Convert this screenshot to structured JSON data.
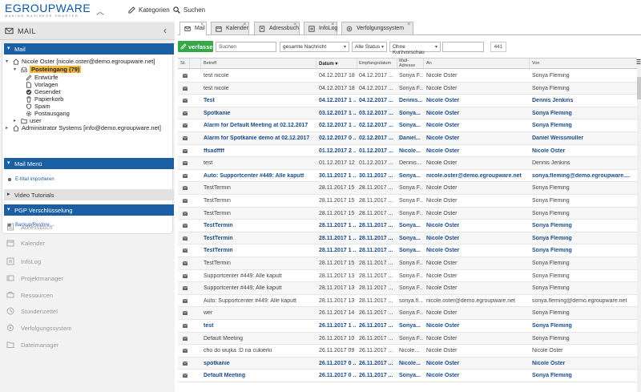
{
  "header": {
    "logo_main": "EGROUPWARE",
    "logo_tagline": "MAKING BUSINESS SMARTER",
    "links": [
      {
        "label": "Kategorien",
        "icon": "edit-icon"
      },
      {
        "label": "Suchen",
        "icon": "search-icon"
      }
    ]
  },
  "sidebar": {
    "app_title": "MAIL",
    "mail_section": "Mail",
    "account": "Nicole Oster [nicole.oster@demo.egroupware.net]",
    "folders": [
      {
        "label": "Posteingang (79)",
        "icon": "inbox-icon",
        "selected": true
      },
      {
        "label": "Entwürfe",
        "icon": "pencil-icon"
      },
      {
        "label": "Vorlagen",
        "icon": "document-icon"
      },
      {
        "label": "Gesendet",
        "icon": "check-icon"
      },
      {
        "label": "Papierkorb",
        "icon": "trash-icon"
      },
      {
        "label": "Spam",
        "icon": "shield-icon"
      },
      {
        "label": "Postausgang",
        "icon": "gear-icon"
      }
    ],
    "user_folder": "user",
    "account2": "Administrator Systems [info@demo.egroupware.net]",
    "mail_menu": "Mail Menü",
    "import_link": "E-Mail importieren",
    "video_tutorials": "Video Tutorials",
    "pgp": "PGP Verschlüsselung",
    "backup_link": "Backup/Restore ...",
    "apps": [
      {
        "label": "Adressbuch",
        "icon": "addressbook-icon"
      },
      {
        "label": "Kalender",
        "icon": "calendar-icon"
      },
      {
        "label": "InfoLog",
        "icon": "infolog-icon"
      },
      {
        "label": "Projektmanager",
        "icon": "project-icon"
      },
      {
        "label": "Ressourcen",
        "icon": "resources-icon"
      },
      {
        "label": "Stundenzettel",
        "icon": "timesheet-icon"
      },
      {
        "label": "Verfolgungssystem",
        "icon": "tracker-icon"
      },
      {
        "label": "Dateimanager",
        "icon": "folder-icon"
      }
    ]
  },
  "tabs": [
    {
      "label": "Mail",
      "active": true
    },
    {
      "label": "Kalender"
    },
    {
      "label": "Adressbuch"
    },
    {
      "label": "InfoLog"
    },
    {
      "label": "Verfolgungssystem"
    }
  ],
  "toolbar": {
    "compose": "verfassen",
    "search_placeholder": "Suchen",
    "search_scope": "gesamte Nachricht",
    "status_filter": "Alle Status",
    "preview_filter": "Ohne Kurzvorschau",
    "count": "441"
  },
  "columns": [
    "St.",
    "",
    "Betreff",
    "Datum",
    "Empfangsdatum",
    "Mail-Adresse",
    "An",
    "Von"
  ],
  "rows": [
    {
      "subject": "test nicole",
      "date": "04.12.2017 18 ...",
      "received": "04.12.2017 ...",
      "mail": "Sonya F...",
      "to": "Nicole Oster",
      "from": "Sonya Fleming",
      "unread": false
    },
    {
      "subject": "test nicole",
      "date": "04.12.2017 18 ...",
      "received": "04.12.2017 ...",
      "mail": "Sonya F...",
      "to": "Nicole Oster",
      "from": "Sonya Fleming",
      "unread": false
    },
    {
      "subject": "Test",
      "date": "04.12.2017 1 ...",
      "received": "04.12.2017 ...",
      "mail": "Dennis...",
      "to": "Nicole Oster",
      "from": "Dennis Jenkins",
      "unread": true
    },
    {
      "subject": "Spotkanie",
      "date": "03.12.2017 1 ...",
      "received": "03.12.2017 ...",
      "mail": "Sonya...",
      "to": "Nicole Oster",
      "from": "Sonya Fleming",
      "unread": true
    },
    {
      "subject": "Alarm for Default Meeting at 02.12.2017",
      "date": "02.12.2017 1 ...",
      "received": "02.12.2017 ...",
      "mail": "Sonya...",
      "to": "Nicole Oster",
      "from": "Sonya Fleming",
      "unread": true
    },
    {
      "subject": "Alarm for Spotkanie demo at 02.12.2017",
      "date": "02.12.2017 0 ...",
      "received": "02.12.2017 ...",
      "mail": "Daniel...",
      "to": "Nicole Oster",
      "from": "Daniel Weissmuller",
      "unread": true
    },
    {
      "subject": "ffsadffff",
      "date": "01.12.2017 2 ...",
      "received": "01.12.2017 ...",
      "mail": "Nicole...",
      "to": "Nicole Oster",
      "from": "Nicole Oster",
      "unread": true
    },
    {
      "subject": "test",
      "date": "01.12.2017 12 ...",
      "received": "01.12.2017 ...",
      "mail": "Dennis...",
      "to": "Nicole Oster",
      "from": "Dennis Jenkins",
      "unread": false
    },
    {
      "subject": "Auto: Supportcenter #449: Alle kaputt",
      "date": "30.11.2017 1 ...",
      "received": "30.11.2017 ...",
      "mail": "Sonya...",
      "to": "nicole.oster@demo.egroupware.net",
      "from": "sonya.fleming@demo.egroupware....",
      "unread": true
    },
    {
      "subject": "TestTermin",
      "date": "28.11.2017 15 ...",
      "received": "28.11.2017 ...",
      "mail": "Sonya F...",
      "to": "Nicole Oster",
      "from": "Sonya Fleming",
      "unread": false
    },
    {
      "subject": "TestTermin",
      "date": "28.11.2017 15 ...",
      "received": "28.11.2017 ...",
      "mail": "Sonya F...",
      "to": "Nicole Oster",
      "from": "Sonya Fleming",
      "unread": false
    },
    {
      "subject": "TestTermin",
      "date": "28.11.2017 15 ...",
      "received": "28.11.2017 ...",
      "mail": "Sonya F...",
      "to": "Nicole Oster",
      "from": "Sonya Fleming",
      "unread": false
    },
    {
      "subject": "TestTermin",
      "date": "28.11.2017 1 ...",
      "received": "28.11.2017 ...",
      "mail": "Sonya...",
      "to": "Nicole Oster",
      "from": "Sonya Fleming",
      "unread": true
    },
    {
      "subject": "TestTermin",
      "date": "28.11.2017 1 ...",
      "received": "28.11.2017 ...",
      "mail": "Sonya...",
      "to": "Nicole Oster",
      "from": "Sonya Fleming",
      "unread": true
    },
    {
      "subject": "TestTermin",
      "date": "28.11.2017 1 ...",
      "received": "28.11.2017 ...",
      "mail": "Sonya...",
      "to": "Nicole Oster",
      "from": "Sonya Fleming",
      "unread": true
    },
    {
      "subject": "TestTermin",
      "date": "28.11.2017 15 ...",
      "received": "28.11.2017 ...",
      "mail": "Sonya F...",
      "to": "Nicole Oster",
      "from": "Sonya Fleming",
      "unread": false
    },
    {
      "subject": "Supportcenter #449: Alle kaputt",
      "date": "28.11.2017 13 ...",
      "received": "28.11.2017 ...",
      "mail": "Sonya F...",
      "to": "Nicole Oster",
      "from": "Sonya Fleming",
      "unread": false
    },
    {
      "subject": "Supportcenter #449: Alle kaputt",
      "date": "28.11.2017 13 ...",
      "received": "28.11.2017 ...",
      "mail": "Sonya F...",
      "to": "Nicole Oster",
      "from": "Sonya Fleming",
      "unread": false
    },
    {
      "subject": "Auto: Supportcenter #449: Alle kaputt",
      "date": "28.11.2017 13 ...",
      "received": "28.11.2017 ...",
      "mail": "sonya.fl...",
      "to": "nicole.oster@demo.egroupware.net",
      "from": "sonya.fleming@demo.egroupware.net",
      "unread": false
    },
    {
      "subject": "wer",
      "date": "26.11.2017 14 ...",
      "received": "26.11.2017 ...",
      "mail": "Sonya F...",
      "to": "Nicole Oster",
      "from": "Sonya Fleming",
      "unread": false
    },
    {
      "subject": "test",
      "date": "26.11.2017 1 ...",
      "received": "26.11.2017 ...",
      "mail": "Sonya...",
      "to": "Nicole Oster",
      "from": "Sonya Fleming",
      "unread": true
    },
    {
      "subject": "Default Meeting",
      "date": "26.11.2017 10 ...",
      "received": "26.11.2017 ...",
      "mail": "Sonya F...",
      "to": "Nicole Oster",
      "from": "Sonya Fleming",
      "unread": false
    },
    {
      "subject": "cho do wujka :D na cukierki",
      "date": "26.11.2017 09 ...",
      "received": "26.11.2017 ...",
      "mail": "Nicole...",
      "to": "Nicole Oster",
      "from": "Nicole Oster",
      "unread": false
    },
    {
      "subject": "spotkanie",
      "date": "26.11.2017 0 ...",
      "received": "26.11.2017 ...",
      "mail": "Nicole...",
      "to": "Nicole Oster",
      "from": "Nicole Oster",
      "unread": true
    },
    {
      "subject": "Default Meeting",
      "date": "26.11.2017 0 ...",
      "received": "26.11.2017 ...",
      "mail": "Sonya...",
      "to": "Nicole Oster",
      "from": "Sonya Fleming",
      "unread": true
    }
  ],
  "colors": {
    "brand_blue": "#1a5ea4",
    "brand_green": "#37a847",
    "inbox_highlight": "#f5b942"
  }
}
